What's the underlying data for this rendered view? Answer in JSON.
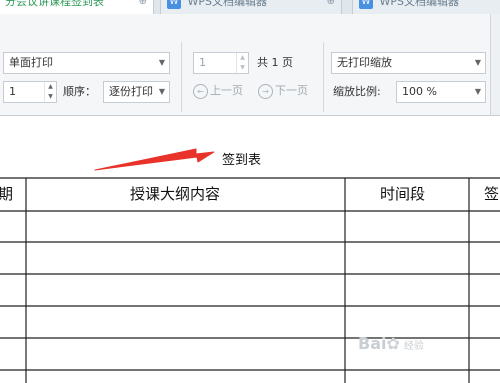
{
  "tabs": [
    {
      "label": "分会议讲课程签到表",
      "active": true
    },
    {
      "label": "WPS文档编辑器",
      "active": false
    },
    {
      "label": "WPS文档编辑器",
      "active": false
    }
  ],
  "ribbon": {
    "print_mode": "单面打印",
    "copies": "1",
    "order_label": "顺序：",
    "order_value": "逐份打印",
    "page_value": "1",
    "total_pages": "共 1 页",
    "prev_page": "上一页",
    "next_page": "下一页",
    "scale_mode": "无打印缩放",
    "zoom_label": "缩放比例:",
    "zoom_value": "100 %"
  },
  "document": {
    "title": "签到表",
    "table_headers": [
      "期",
      "授课大纲内容",
      "时间段",
      "签"
    ]
  },
  "watermark": {
    "text": "Bai",
    "text2": "经验"
  },
  "colors": {
    "arrow": "#e8332a",
    "active_tab_text": "#2e9a57"
  }
}
